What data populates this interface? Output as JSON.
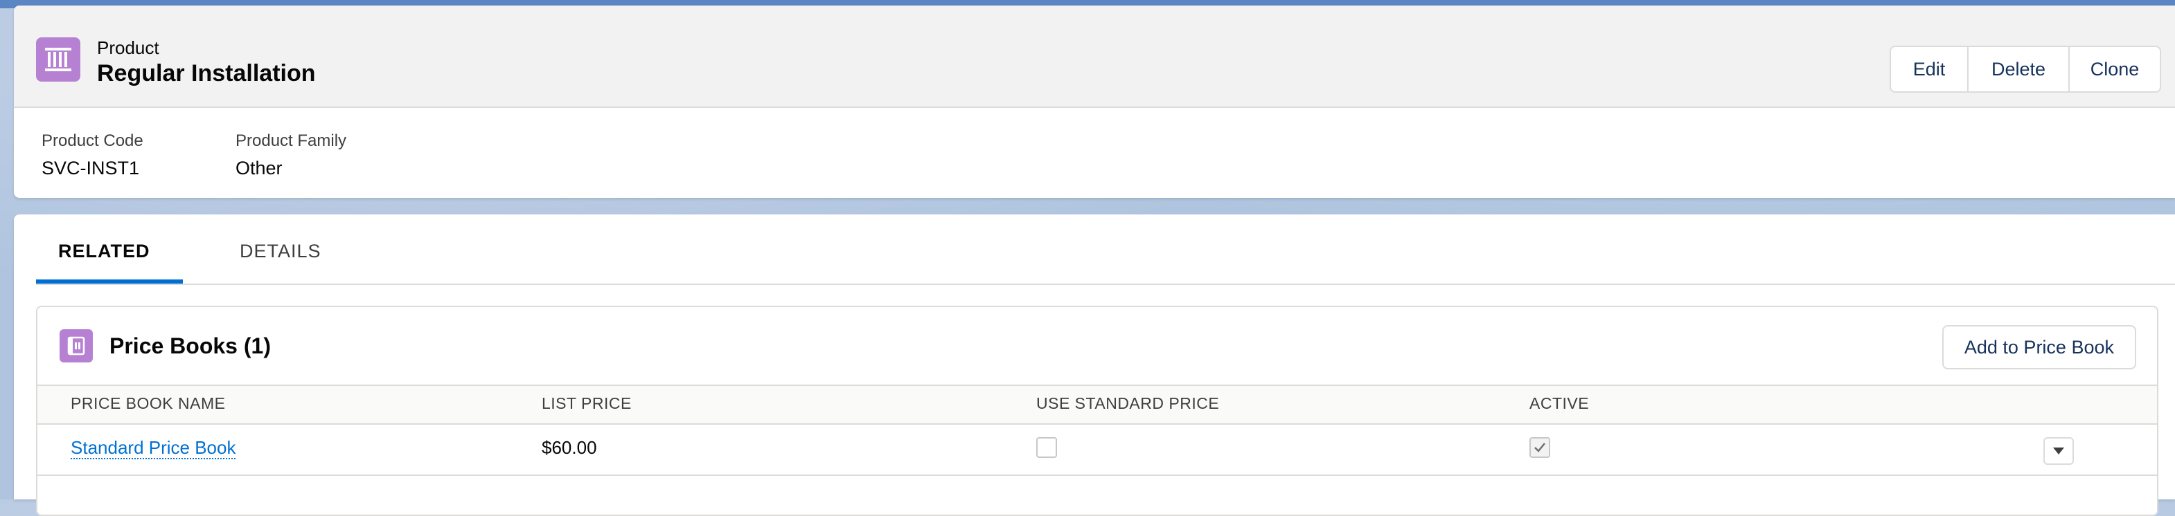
{
  "record": {
    "object_label": "Product",
    "title": "Regular Installation",
    "icon": "product-icon",
    "actions": {
      "edit": "Edit",
      "delete": "Delete",
      "clone": "Clone"
    },
    "fields": [
      {
        "label": "Product Code",
        "value": "SVC-INST1"
      },
      {
        "label": "Product Family",
        "value": "Other"
      }
    ]
  },
  "tabs": {
    "related": "RELATED",
    "details": "DETAILS",
    "active": "RELATED"
  },
  "related_list": {
    "title": "Price Books (1)",
    "icon": "price-book-icon",
    "add_button": "Add to Price Book",
    "columns": [
      "PRICE BOOK NAME",
      "LIST PRICE",
      "USE STANDARD PRICE",
      "ACTIVE"
    ],
    "rows": [
      {
        "name": "Standard Price Book",
        "list_price": "$60.00",
        "use_standard_price": false,
        "active": true
      }
    ]
  },
  "colors": {
    "accent": "#0070d2",
    "product_icon": "#b781d3"
  }
}
